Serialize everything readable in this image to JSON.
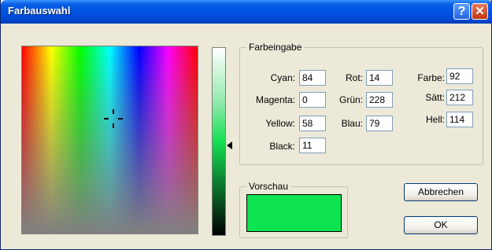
{
  "window": {
    "title": "Farbauswahl",
    "help": "?",
    "close": "✕"
  },
  "input_group": {
    "title": "Farbeingabe",
    "cmyk": [
      {
        "label": "Cyan:",
        "value": "84",
        "accel": "C"
      },
      {
        "label": "Magenta:",
        "value": "0",
        "accel": "M"
      },
      {
        "label": "Yellow:",
        "value": "58",
        "accel": "Y"
      },
      {
        "label": "Black:",
        "value": "11",
        "accel": "B"
      }
    ],
    "rgb": [
      {
        "label": "Rot:",
        "value": "14",
        "accel": "R"
      },
      {
        "label": "Grün:",
        "value": "228",
        "accel": "G"
      },
      {
        "label": "Blau:",
        "value": "79",
        "accel": "B"
      }
    ],
    "hsl": [
      {
        "label": "Farbe:",
        "value": "92",
        "accel": "F"
      },
      {
        "label": "Sätt:",
        "value": "212",
        "accel": "S"
      },
      {
        "label": "Hell:",
        "value": "114",
        "accel": "e"
      }
    ]
  },
  "preview": {
    "title": "Vorschau",
    "color": "#0ee44f"
  },
  "buttons": {
    "cancel": "Abbrechen",
    "ok": "OK"
  },
  "colors": {
    "titlebar": "#0054e3",
    "selected": "#0ee44f"
  }
}
